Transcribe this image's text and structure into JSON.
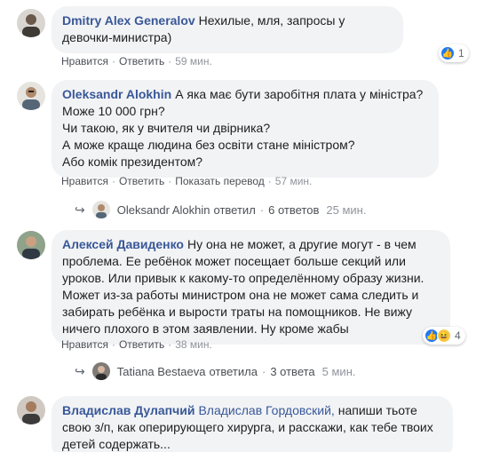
{
  "comments": [
    {
      "author": "Dmitry Alex Generalov",
      "text": "Нехилые, мля, запросы у девочки-министра)",
      "like": "Нравится",
      "reply": "Ответить",
      "time": "59 мин.",
      "reaction_count": "1"
    },
    {
      "author": "Oleksandr Alokhin",
      "text_lines": [
        "А яка має бути заробітня плата у міністра?",
        "Може 10 000 грн?",
        "Чи такою, як у вчителя чи двірника?",
        "А може краще людина без освіти стане міністром?",
        "Або комік президентом?"
      ],
      "like": "Нравится",
      "reply": "Ответить",
      "translate": "Показать перевод",
      "time": "57 мин.",
      "replies": {
        "name": "Oleksandr Alokhin",
        "verb": "ответил",
        "count": "6 ответов",
        "time": "25 мин."
      }
    },
    {
      "author": "Алексей Давиденко",
      "text": "Ну она не может, а другие могут - в чем проблема. Ее ребёнок может посещает больше секций или уроков. Или привык к какому-то определённому образу жизни. Может из-за работы министром она не может сама следить и забирать ребёнка и вырости траты на помощников. Не вижу ничего плохого в этом заявлении. Ну кроме жабы",
      "like": "Нравится",
      "reply": "Ответить",
      "time": "38 мин.",
      "reaction_count": "4",
      "replies": {
        "name": "Tatiana Bestaeva",
        "verb": "ответила",
        "count": "3 ответа",
        "time": "5 мин."
      }
    },
    {
      "author": "Владислав Дулапчий",
      "mention": "Владислав Гордовский,",
      "text": "напиши тьоте свою з/п, как оперирующего хирурга, и расскажи, как тебе твоих детей содержать..."
    }
  ],
  "icons": {
    "like": "like-icon",
    "haha": "haha-icon",
    "reply_arrow": "reply-arrow-icon"
  },
  "colors": {
    "author": "#385898",
    "bubble": "#f2f3f5",
    "like_blue": "#2078f4"
  }
}
